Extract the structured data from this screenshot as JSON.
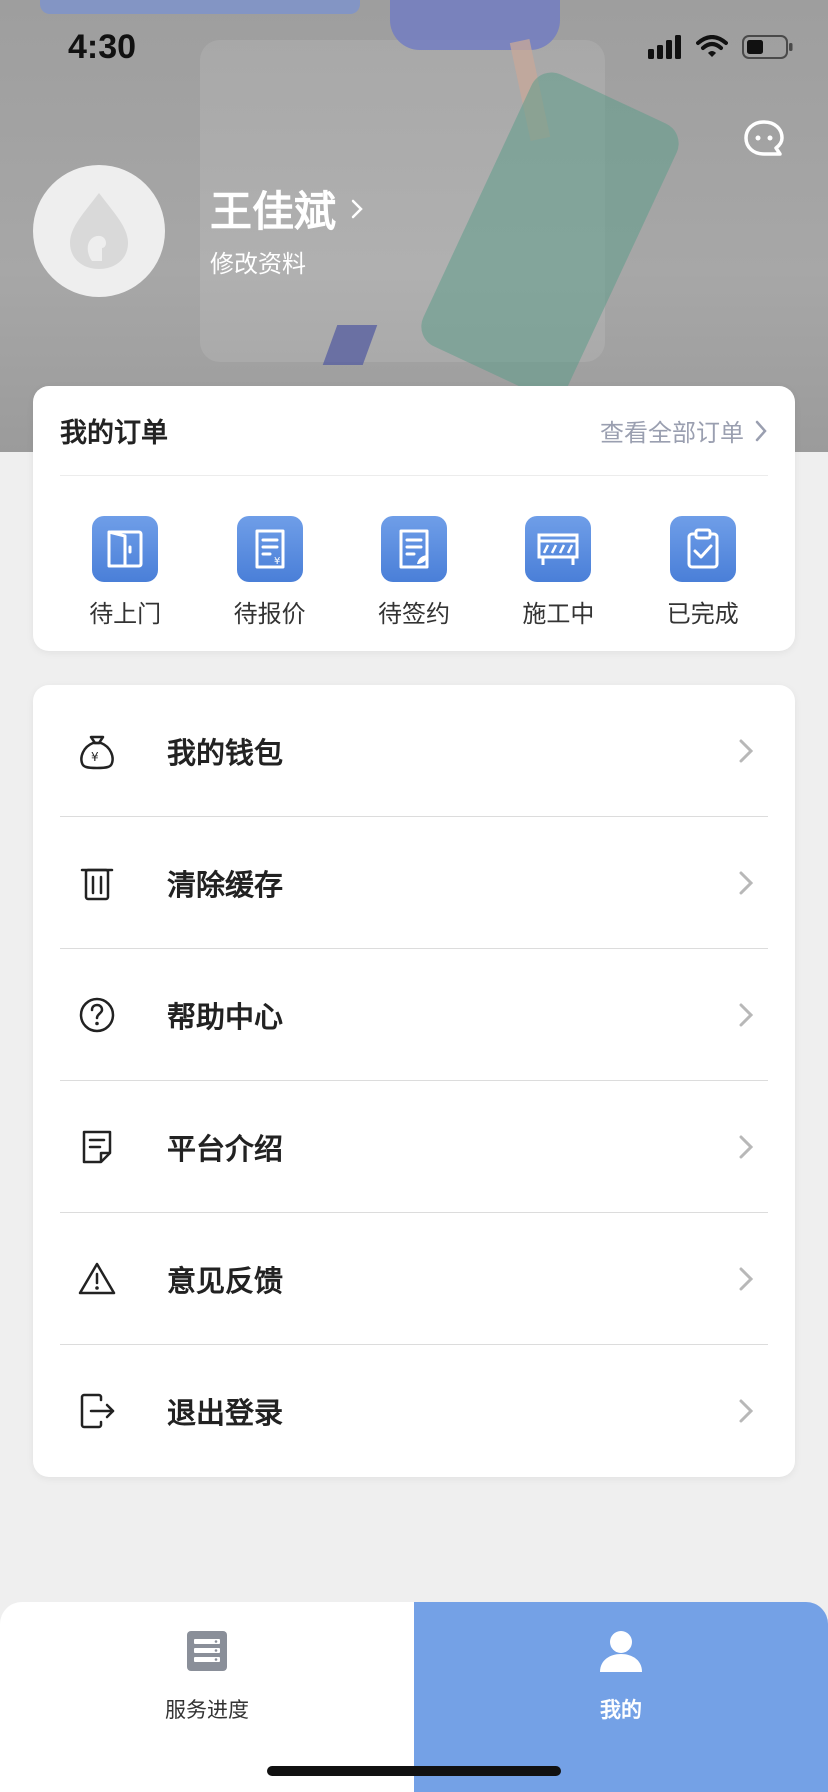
{
  "status_bar": {
    "time": "4:30"
  },
  "profile": {
    "name": "王佳斌",
    "edit_label": "修改资料"
  },
  "orders": {
    "title": "我的订单",
    "view_all": "查看全部订单",
    "items": [
      {
        "label": "待上门",
        "icon": "door-icon"
      },
      {
        "label": "待报价",
        "icon": "quote-document-icon"
      },
      {
        "label": "待签约",
        "icon": "sign-document-icon"
      },
      {
        "label": "施工中",
        "icon": "construction-barrier-icon"
      },
      {
        "label": "已完成",
        "icon": "clipboard-check-icon"
      }
    ]
  },
  "menu": {
    "items": [
      {
        "label": "我的钱包",
        "icon": "wallet-bag-icon"
      },
      {
        "label": "清除缓存",
        "icon": "trash-icon"
      },
      {
        "label": "帮助中心",
        "icon": "question-circle-icon"
      },
      {
        "label": "平台介绍",
        "icon": "note-icon"
      },
      {
        "label": "意见反馈",
        "icon": "warning-triangle-icon"
      },
      {
        "label": "退出登录",
        "icon": "logout-icon"
      }
    ]
  },
  "tabbar": {
    "tabs": [
      {
        "label": "服务进度",
        "icon": "server-list-icon",
        "active": false
      },
      {
        "label": "我的",
        "icon": "user-icon",
        "active": true
      }
    ]
  },
  "colors": {
    "accent": "#74a1e6",
    "icon_gradient_top": "#6f9ee8",
    "icon_gradient_bottom": "#4a7fd8",
    "muted_text": "#9a9fb0"
  }
}
